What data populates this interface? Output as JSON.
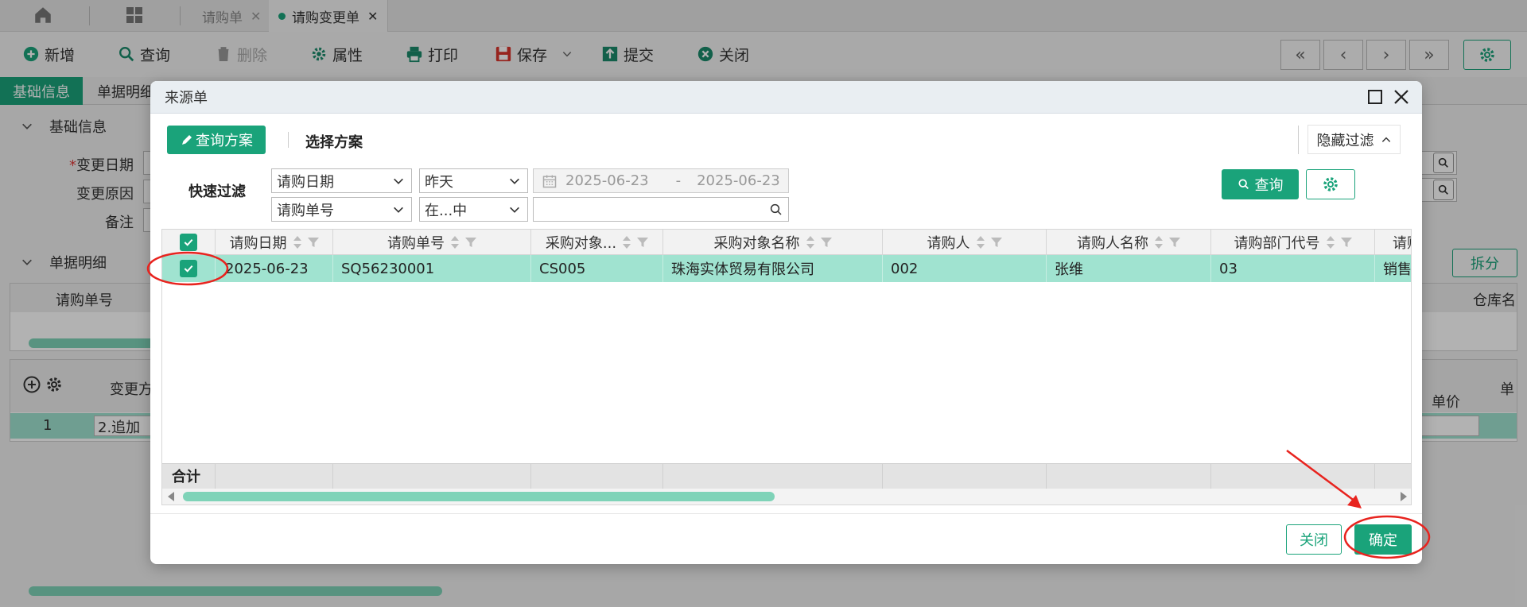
{
  "topbar": {
    "tabs": [
      {
        "label": "请购单",
        "close": "✕"
      },
      {
        "label": "请购变更单",
        "close": "✕"
      }
    ]
  },
  "toolbar": {
    "add": "新增",
    "query": "查询",
    "delete": "删除",
    "props": "属性",
    "print": "打印",
    "save": "保存",
    "submit": "提交",
    "close": "关闭"
  },
  "subtabs": {
    "basic": "基础信息",
    "detail": "单据明细"
  },
  "basic_section": {
    "title": "基础信息",
    "change_date": "变更日期",
    "change_reason": "变更原因",
    "remark": "备注"
  },
  "detail_section": {
    "title": "单据明细",
    "split": "拆分",
    "col_req_no": "请购单号",
    "col_warehouse": "仓库名",
    "col_change": "变更方",
    "col_unit_price": "单价",
    "col_unit_short": "单",
    "row_index": "1",
    "row_change": "2.追加"
  },
  "dialog": {
    "title": "来源单",
    "query_scheme": "查询方案",
    "select_scheme": "选择方案",
    "hide_filter": "隐藏过滤",
    "quick_filter": "快速过滤",
    "filter1_field": "请购日期",
    "filter1_op": "昨天",
    "date_from": "2025-06-23",
    "date_sep": "-",
    "date_to": "2025-06-23",
    "filter2_field": "请购单号",
    "filter2_op": "在...中",
    "filter2_value": "",
    "query_btn": "查询",
    "columns": [
      "请购日期",
      "请购单号",
      "采购对象...",
      "采购对象名称",
      "请购人",
      "请购人名称",
      "请购部门代号",
      "请购"
    ],
    "rows": [
      [
        "2025-06-23",
        "SQ56230001",
        "CS005",
        "珠海实体贸易有限公司",
        "002",
        "张维",
        "03",
        "销售"
      ]
    ],
    "total_label": "合计",
    "close_btn": "关闭",
    "ok_btn": "确定"
  },
  "colors": {
    "accent": "#1aa37a",
    "row_selected": "#a0e3d0",
    "annotation": "#e8231e"
  }
}
